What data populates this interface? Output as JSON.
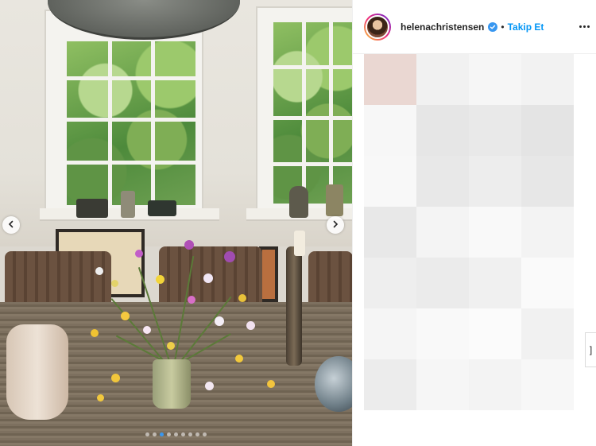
{
  "post": {
    "username": "helenachristensen",
    "verified": true,
    "separator": "•",
    "follow_label": "Takip Et",
    "more_options_icon": "more-horizontal-icon"
  },
  "carousel": {
    "slide_count": 9,
    "active_slide": 3,
    "prev_icon": "chevron-left-icon",
    "next_icon": "chevron-right-icon"
  },
  "comments": {
    "state": "pixelated"
  },
  "colors": {
    "accent": "#0095f6",
    "active_dot": "#3897f0",
    "text": "#262626",
    "divider": "#efefef"
  },
  "scroll_handle": {
    "glyph": "]"
  }
}
